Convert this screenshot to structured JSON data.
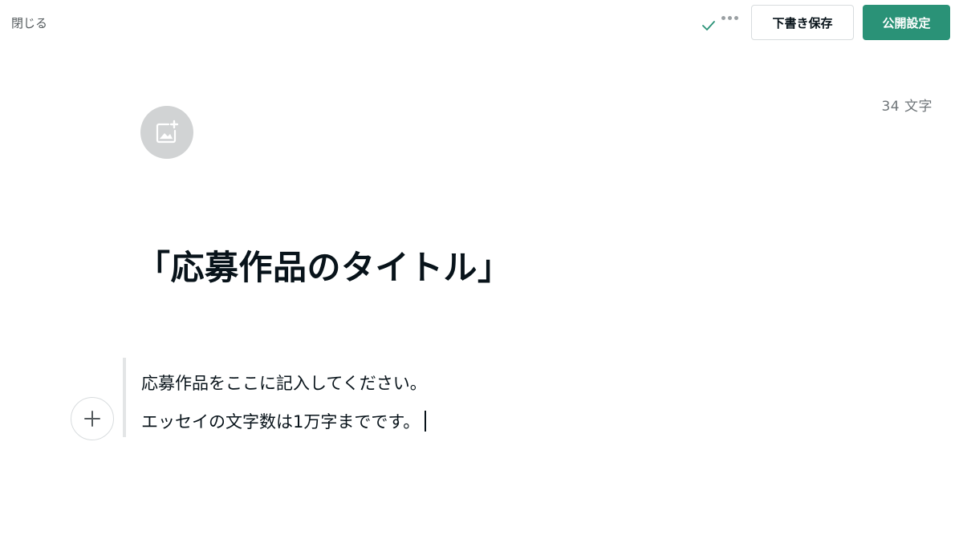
{
  "header": {
    "close_label": "閉じる",
    "save_status_icon": "check-icon",
    "more_icon": "more-options-icon",
    "draft_save_label": "下書き保存",
    "publish_settings_label": "公開設定"
  },
  "colors": {
    "accent": "#2a9277",
    "text": "#08131a",
    "muted": "#6f7579"
  },
  "editor": {
    "char_count": "34 文字",
    "image_icon": "add-image-icon",
    "title": "「応募作品のタイトル」",
    "body_lines": [
      "応募作品をここに記入してください。",
      "エッセイの文字数は1万字までです。"
    ],
    "insert_icon": "plus-icon"
  }
}
